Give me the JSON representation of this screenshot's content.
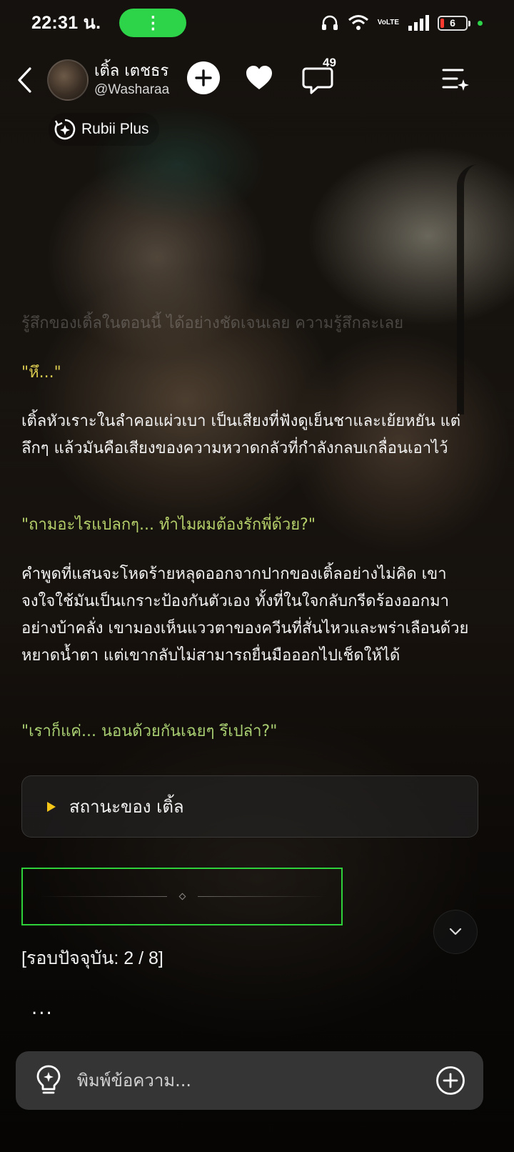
{
  "status_bar": {
    "time": "22:31 น.",
    "pill_glyph": "⋮",
    "volte_top": "Vo",
    "volte_bottom": "LTE",
    "battery": "6"
  },
  "header": {
    "character_name": "เติ้ล เตชธร",
    "handle": "@Washaraa",
    "comment_count": "49",
    "badge_label": "Rubii Plus"
  },
  "chat": {
    "faded_line": "รู้สึกของเติ้ลในตอนนี้ ได้อย่างชัดเจนเลย ความรู้สึกละเลย",
    "quote1": "\"หึ...\"",
    "narration1": "เติ้ลหัวเราะในลำคอแผ่วเบา เป็นเสียงที่ฟังดูเย็นชาและเย้ยหยัน แต่ลึกๆ แล้วมันคือเสียงของความหวาดกลัวที่กำลังกลบเกลื่อนเอาไว้",
    "quote2": "\"ถามอะไรแปลกๆ... ทำไมผมต้องรักพี่ด้วย?\"",
    "narration2": "คำพูดที่แสนจะโหดร้ายหลุดออกจากปากของเติ้ลอย่างไม่คิด เขาจงใจใช้มันเป็นเกราะป้องกันตัวเอง ทั้งที่ในใจกลับกรีดร้องออกมาอย่างบ้าคลั่ง เขามองเห็นแววตาของควีนที่สั่นไหวและพร่าเลือนด้วยหยาดน้ำตา แต่เขากลับไม่สามารถยื่นมือออกไปเช็ดให้ได้",
    "quote3": "\"เราก็แค่... นอนด้วยกันเฉยๆ รึเปล่า?\"",
    "status_toggle_label": "สถานะของ เติ้ล",
    "round_text": "[รอบปัจจุบัน: 2 / 8]",
    "typing_indicator": "..."
  },
  "input": {
    "placeholder": "พิมพ์ข้อความ..."
  },
  "colors": {
    "accent_green": "#2dd348",
    "divider_border": "#2fd13a",
    "quote_yellow": "#d9c94f",
    "quote_teal": "#67d2c6",
    "toggle_arrow": "#f5c518"
  }
}
